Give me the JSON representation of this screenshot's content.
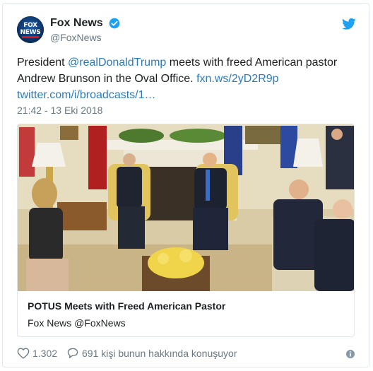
{
  "user": {
    "display_name": "Fox News",
    "handle": "@FoxNews",
    "avatar_text_line1": "FOX",
    "avatar_text_line2": "NEWS"
  },
  "tweet": {
    "text_part1": "President ",
    "mention": "@realDonaldTrump",
    "text_part2": " meets with freed American pastor Andrew Brunson in the Oval Office. ",
    "link1": "fxn.ws/2yD2R9p",
    "link2": "twitter.com/i/broadcasts/1…",
    "timestamp": "21:42 - 13 Eki 2018"
  },
  "card": {
    "title": "POTUS Meets with Freed American Pastor",
    "author": "Fox News @FoxNews"
  },
  "actions": {
    "likes": "1.302",
    "replies_text": "691 kişi bunun hakkında konuşuyor"
  },
  "colors": {
    "link": "#2b7bb9",
    "twitter_blue": "#1da1f2",
    "muted": "#697882"
  }
}
